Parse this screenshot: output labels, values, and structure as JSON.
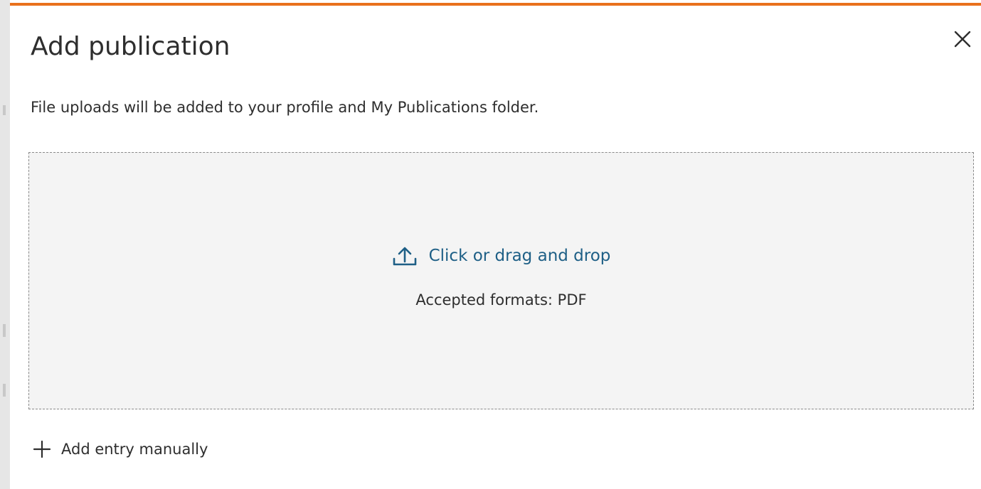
{
  "dialog": {
    "title": "Add publication",
    "subtitle": "File uploads will be added to your profile and My Publications folder.",
    "close_icon": "close-icon",
    "accent_color": "#e9711c"
  },
  "dropzone": {
    "label": "Click or drag and drop",
    "icon": "upload-icon",
    "accepted_formats": "Accepted formats: PDF",
    "link_color": "#1e5f86"
  },
  "manual_entry": {
    "label": "Add entry manually",
    "icon": "plus-icon"
  }
}
